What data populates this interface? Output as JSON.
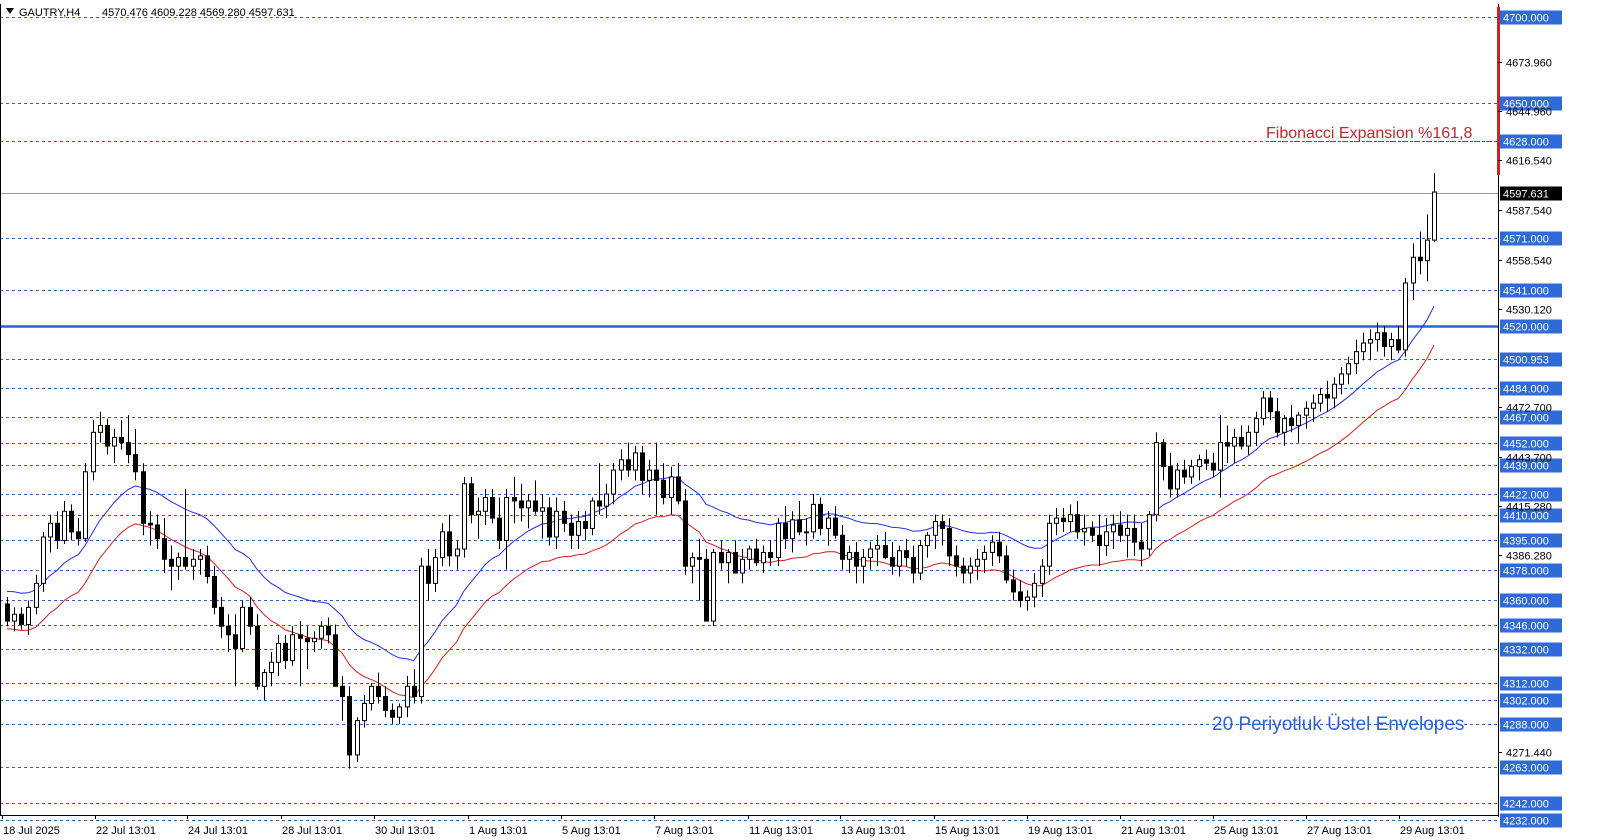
{
  "header": {
    "symbol": "GAUTRY,H4",
    "ohlc": "4570.476 4609.228 4569.280 4597.631"
  },
  "annotations": {
    "fibonacci": "Fibonacci Expansion %161,8",
    "envelopes": "20 Periyotluk Üstel Envelopes"
  },
  "colors": {
    "grid": "#2f5fd8",
    "upper_envelope": "#1e2ff0",
    "lower_envelope": "#e01b1b",
    "support": "#2f5fd8",
    "fib_line": "#c0282d",
    "level_badge": "#2f6bd8",
    "current_badge": "#000000"
  },
  "chart_data": {
    "type": "candlestick",
    "timeframe": "H4",
    "ylim": [
      4232,
      4703
    ],
    "current_price": 4597.631,
    "current_price_label": "4597.631",
    "support_level": 4520,
    "fib_level": 4628,
    "price_levels": [
      "4700.000",
      "4650.000",
      "4628.000",
      "4571.000",
      "4541.000",
      "4520.000",
      "4500.953",
      "4484.000",
      "4467.000",
      "4452.000",
      "4439.000",
      "4422.000",
      "4410.000",
      "4395.000",
      "4378.000",
      "4360.000",
      "4346.000",
      "4332.000",
      "4312.000",
      "4302.000",
      "4288.000",
      "4263.000",
      "4242.000",
      "4232.000"
    ],
    "axis_ticks": [
      "4673.960",
      "4644.960",
      "4616.540",
      "4587.540",
      "4558.540",
      "4530.120",
      "4472.700",
      "4443.700",
      "4415.280",
      "4386.280",
      "4271.440"
    ],
    "x_labels": [
      "18 Jul 2025",
      "22 Jul 13:01",
      "24 Jul 13:01",
      "28 Jul 13:01",
      "30 Jul 13:01",
      "1 Aug 13:01",
      "5 Aug 13:01",
      "7 Aug 13:01",
      "11 Aug 13:01",
      "13 Aug 13:01",
      "15 Aug 13:01",
      "19 Aug 13:01",
      "21 Aug 13:01",
      "25 Aug 13:01",
      "27 Aug 13:01",
      "29 Aug 13:01"
    ],
    "candles": [
      [
        4358,
        4362,
        4345,
        4348
      ],
      [
        4348,
        4356,
        4342,
        4352
      ],
      [
        4352,
        4356,
        4343,
        4346
      ],
      [
        4346,
        4360,
        4340,
        4356
      ],
      [
        4356,
        4375,
        4352,
        4370
      ],
      [
        4370,
        4400,
        4365,
        4397
      ],
      [
        4397,
        4410,
        4388,
        4405
      ],
      [
        4405,
        4412,
        4390,
        4395
      ],
      [
        4395,
        4418,
        4393,
        4412
      ],
      [
        4412,
        4416,
        4395,
        4400
      ],
      [
        4400,
        4408,
        4392,
        4396
      ],
      [
        4396,
        4440,
        4394,
        4435
      ],
      [
        4435,
        4465,
        4430,
        4458
      ],
      [
        4458,
        4470,
        4452,
        4462
      ],
      [
        4462,
        4466,
        4445,
        4450
      ],
      [
        4450,
        4460,
        4440,
        4455
      ],
      [
        4455,
        4465,
        4448,
        4452
      ],
      [
        4452,
        4468,
        4440,
        4445
      ],
      [
        4445,
        4460,
        4430,
        4435
      ],
      [
        4435,
        4440,
        4398,
        4405
      ],
      [
        4405,
        4412,
        4392,
        4404
      ],
      [
        4404,
        4410,
        4390,
        4396
      ],
      [
        4396,
        4408,
        4376,
        4384
      ],
      [
        4384,
        4392,
        4366,
        4380
      ],
      [
        4380,
        4388,
        4372,
        4385
      ],
      [
        4385,
        4425,
        4378,
        4380
      ],
      [
        4380,
        4390,
        4372,
        4384
      ],
      [
        4384,
        4390,
        4375,
        4386
      ],
      [
        4386,
        4392,
        4370,
        4374
      ],
      [
        4374,
        4380,
        4352,
        4356
      ],
      [
        4356,
        4362,
        4338,
        4345
      ],
      [
        4345,
        4352,
        4330,
        4340
      ],
      [
        4340,
        4352,
        4310,
        4332
      ],
      [
        4332,
        4360,
        4330,
        4356
      ],
      [
        4356,
        4362,
        4340,
        4345
      ],
      [
        4345,
        4352,
        4308,
        4310
      ],
      [
        4310,
        4320,
        4302,
        4318
      ],
      [
        4318,
        4330,
        4310,
        4324
      ],
      [
        4324,
        4340,
        4316,
        4335
      ],
      [
        4335,
        4340,
        4320,
        4325
      ],
      [
        4325,
        4345,
        4322,
        4340
      ],
      [
        4340,
        4348,
        4310,
        4338
      ],
      [
        4338,
        4345,
        4320,
        4336
      ],
      [
        4336,
        4342,
        4330,
        4338
      ],
      [
        4338,
        4348,
        4332,
        4345
      ],
      [
        4345,
        4350,
        4335,
        4340
      ],
      [
        4340,
        4346,
        4310,
        4310
      ],
      [
        4310,
        4316,
        4290,
        4304
      ],
      [
        4304,
        4310,
        4262,
        4270
      ],
      [
        4270,
        4292,
        4266,
        4290
      ],
      [
        4290,
        4305,
        4286,
        4300
      ],
      [
        4300,
        4312,
        4296,
        4310
      ],
      [
        4310,
        4318,
        4300,
        4304
      ],
      [
        4304,
        4310,
        4292,
        4296
      ],
      [
        4296,
        4300,
        4288,
        4292
      ],
      [
        4292,
        4300,
        4288,
        4298
      ],
      [
        4298,
        4316,
        4292,
        4310
      ],
      [
        4310,
        4320,
        4300,
        4304
      ],
      [
        4304,
        4385,
        4300,
        4380
      ],
      [
        4380,
        4390,
        4360,
        4370
      ],
      [
        4370,
        4390,
        4365,
        4385
      ],
      [
        4385,
        4405,
        4380,
        4400
      ],
      [
        4400,
        4410,
        4380,
        4386
      ],
      [
        4386,
        4395,
        4378,
        4390
      ],
      [
        4390,
        4432,
        4385,
        4428
      ],
      [
        4428,
        4432,
        4405,
        4410
      ],
      [
        4410,
        4420,
        4396,
        4412
      ],
      [
        4412,
        4425,
        4404,
        4420
      ],
      [
        4420,
        4425,
        4405,
        4408
      ],
      [
        4408,
        4420,
        4390,
        4395
      ],
      [
        4395,
        4425,
        4378,
        4420
      ],
      [
        4420,
        4432,
        4405,
        4418
      ],
      [
        4418,
        4428,
        4406,
        4414
      ],
      [
        4414,
        4422,
        4402,
        4418
      ],
      [
        4418,
        4430,
        4410,
        4412
      ],
      [
        4412,
        4422,
        4396,
        4414
      ],
      [
        4414,
        4420,
        4392,
        4397
      ],
      [
        4397,
        4420,
        4390,
        4412
      ],
      [
        4412,
        4418,
        4400,
        4405
      ],
      [
        4405,
        4410,
        4390,
        4398
      ],
      [
        4398,
        4412,
        4390,
        4406
      ],
      [
        4406,
        4412,
        4395,
        4402
      ],
      [
        4402,
        4420,
        4398,
        4418
      ],
      [
        4418,
        4440,
        4410,
        4415
      ],
      [
        4415,
        4428,
        4408,
        4422
      ],
      [
        4422,
        4440,
        4416,
        4436
      ],
      [
        4436,
        4448,
        4430,
        4442
      ],
      [
        4442,
        4452,
        4432,
        4436
      ],
      [
        4436,
        4450,
        4430,
        4446
      ],
      [
        4446,
        4450,
        4422,
        4430
      ],
      [
        4430,
        4442,
        4420,
        4436
      ],
      [
        4436,
        4452,
        4410,
        4430
      ],
      [
        4430,
        4440,
        4416,
        4420
      ],
      [
        4420,
        4438,
        4410,
        4432
      ],
      [
        4432,
        4440,
        4416,
        4418
      ],
      [
        4418,
        4425,
        4375,
        4380
      ],
      [
        4380,
        4388,
        4370,
        4385
      ],
      [
        4385,
        4396,
        4360,
        4384
      ],
      [
        4384,
        4390,
        4348,
        4348
      ],
      [
        4348,
        4390,
        4345,
        4388
      ],
      [
        4388,
        4395,
        4378,
        4382
      ],
      [
        4382,
        4390,
        4370,
        4388
      ],
      [
        4388,
        4395,
        4376,
        4376
      ],
      [
        4376,
        4390,
        4370,
        4384
      ],
      [
        4384,
        4392,
        4378,
        4390
      ],
      [
        4390,
        4396,
        4380,
        4382
      ],
      [
        4382,
        4392,
        4376,
        4388
      ],
      [
        4388,
        4395,
        4380,
        4385
      ],
      [
        4385,
        4408,
        4380,
        4405
      ],
      [
        4405,
        4415,
        4390,
        4396
      ],
      [
        4396,
        4412,
        4388,
        4407
      ],
      [
        4407,
        4418,
        4398,
        4400
      ],
      [
        4400,
        4408,
        4392,
        4400
      ],
      [
        4400,
        4422,
        4396,
        4416
      ],
      [
        4416,
        4420,
        4398,
        4402
      ],
      [
        4402,
        4412,
        4392,
        4408
      ],
      [
        4408,
        4415,
        4396,
        4398
      ],
      [
        4398,
        4404,
        4378,
        4384
      ],
      [
        4384,
        4392,
        4376,
        4388
      ],
      [
        4388,
        4394,
        4370,
        4380
      ],
      [
        4380,
        4390,
        4370,
        4385
      ],
      [
        4385,
        4394,
        4378,
        4390
      ],
      [
        4390,
        4398,
        4380,
        4392
      ],
      [
        4392,
        4400,
        4384,
        4385
      ],
      [
        4385,
        4394,
        4375,
        4380
      ],
      [
        4380,
        4392,
        4374,
        4389
      ],
      [
        4389,
        4396,
        4380,
        4385
      ],
      [
        4385,
        4392,
        4370,
        4376
      ],
      [
        4376,
        4395,
        4372,
        4392
      ],
      [
        4392,
        4400,
        4385,
        4398
      ],
      [
        4398,
        4410,
        4390,
        4406
      ],
      [
        4406,
        4410,
        4392,
        4402
      ],
      [
        4402,
        4408,
        4380,
        4386
      ],
      [
        4386,
        4392,
        4374,
        4380
      ],
      [
        4380,
        4385,
        4370,
        4376
      ],
      [
        4376,
        4385,
        4370,
        4380
      ],
      [
        4380,
        4390,
        4372,
        4384
      ],
      [
        4384,
        4392,
        4376,
        4388
      ],
      [
        4388,
        4398,
        4380,
        4394
      ],
      [
        4394,
        4400,
        4382,
        4386
      ],
      [
        4386,
        4392,
        4370,
        4372
      ],
      [
        4372,
        4378,
        4360,
        4365
      ],
      [
        4365,
        4372,
        4356,
        4360
      ],
      [
        4360,
        4366,
        4354,
        4362
      ],
      [
        4362,
        4376,
        4356,
        4370
      ],
      [
        4370,
        4384,
        4362,
        4380
      ],
      [
        4380,
        4410,
        4375,
        4405
      ],
      [
        4405,
        4414,
        4398,
        4408
      ],
      [
        4408,
        4414,
        4400,
        4406
      ],
      [
        4406,
        4416,
        4400,
        4410
      ],
      [
        4410,
        4418,
        4396,
        4400
      ],
      [
        4400,
        4410,
        4392,
        4402
      ],
      [
        4402,
        4406,
        4394,
        4398
      ],
      [
        4398,
        4410,
        4380,
        4392
      ],
      [
        4392,
        4408,
        4386,
        4400
      ],
      [
        4400,
        4410,
        4390,
        4404
      ],
      [
        4404,
        4412,
        4394,
        4398
      ],
      [
        4398,
        4410,
        4385,
        4402
      ],
      [
        4402,
        4410,
        4386,
        4394
      ],
      [
        4394,
        4405,
        4380,
        4390
      ],
      [
        4390,
        4412,
        4386,
        4410
      ],
      [
        4410,
        4458,
        4406,
        4452
      ],
      [
        4452,
        4454,
        4430,
        4438
      ],
      [
        4438,
        4446,
        4420,
        4425
      ],
      [
        4425,
        4440,
        4420,
        4436
      ],
      [
        4436,
        4442,
        4428,
        4432
      ],
      [
        4432,
        4442,
        4428,
        4438
      ],
      [
        4438,
        4445,
        4430,
        4442
      ],
      [
        4442,
        4448,
        4436,
        4440
      ],
      [
        4440,
        4446,
        4432,
        4436
      ],
      [
        4436,
        4468,
        4420,
        4452
      ],
      [
        4452,
        4462,
        4440,
        4450
      ],
      [
        4450,
        4460,
        4440,
        4455
      ],
      [
        4455,
        4462,
        4448,
        4450
      ],
      [
        4450,
        4462,
        4445,
        4458
      ],
      [
        4458,
        4470,
        4450,
        4466
      ],
      [
        4466,
        4482,
        4462,
        4478
      ],
      [
        4478,
        4482,
        4465,
        4470
      ],
      [
        4470,
        4478,
        4455,
        4458
      ],
      [
        4458,
        4468,
        4450,
        4466
      ],
      [
        4466,
        4474,
        4458,
        4462
      ],
      [
        4462,
        4470,
        4452,
        4468
      ],
      [
        4468,
        4476,
        4460,
        4472
      ],
      [
        4472,
        4480,
        4464,
        4475
      ],
      [
        4475,
        4484,
        4470,
        4480
      ],
      [
        4480,
        4488,
        4470,
        4478
      ],
      [
        4478,
        4490,
        4472,
        4486
      ],
      [
        4486,
        4496,
        4480,
        4492
      ],
      [
        4492,
        4502,
        4486,
        4498
      ],
      [
        4498,
        4512,
        4492,
        4505
      ],
      [
        4505,
        4516,
        4500,
        4510
      ],
      [
        4510,
        4518,
        4500,
        4512
      ],
      [
        4512,
        4522,
        4505,
        4516
      ],
      [
        4516,
        4520,
        4502,
        4508
      ],
      [
        4508,
        4516,
        4500,
        4512
      ],
      [
        4512,
        4520,
        4504,
        4506
      ],
      [
        4506,
        4548,
        4502,
        4545
      ],
      [
        4545,
        4568,
        4535,
        4560
      ],
      [
        4560,
        4575,
        4550,
        4558
      ],
      [
        4558,
        4585,
        4546,
        4570
      ],
      [
        4570,
        4609,
        4569,
        4598
      ]
    ]
  }
}
